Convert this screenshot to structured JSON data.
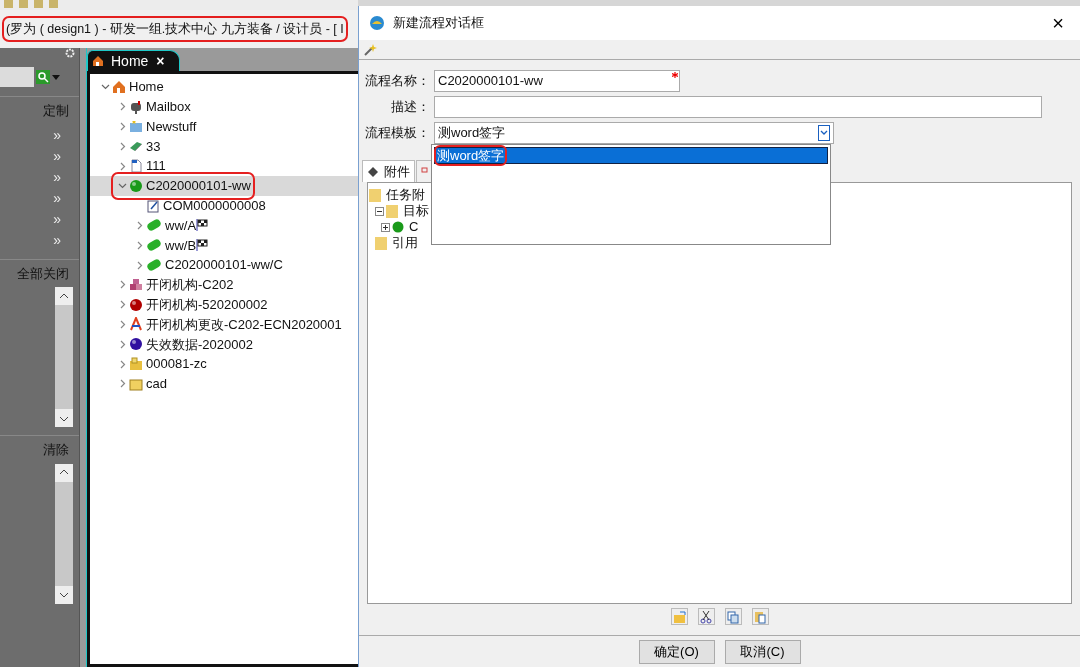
{
  "app_title": {
    "text": "(罗为 ( design1 ) - 研发一组.技术中心 九方装备 / 设计员 - [ I",
    "highlighted": true
  },
  "left_panel": {
    "sections": [
      {
        "button": "定制",
        "rows": [
          "»",
          "»",
          "»",
          "»",
          "»",
          "»"
        ]
      },
      {
        "button": "全部关闭",
        "scroll": true
      },
      {
        "button": "清除",
        "scroll": true
      }
    ]
  },
  "tree_tab": {
    "label": "Home",
    "close": "×"
  },
  "tree": [
    {
      "label": "Home",
      "kind": "house",
      "expanded": true,
      "selected": false,
      "children": [
        {
          "label": "Mailbox",
          "kind": "mailbox",
          "expanded": false,
          "selected": false
        },
        {
          "label": "Newstuff",
          "kind": "folder-star",
          "expanded": false,
          "selected": false
        },
        {
          "label": "33",
          "kind": "book",
          "expanded": false,
          "selected": false
        },
        {
          "label": "111",
          "kind": "document",
          "expanded": false,
          "selected": false
        },
        {
          "label": "C2020000101-ww",
          "kind": "sphere",
          "color": "#1a9a1a",
          "expanded": true,
          "selected": true,
          "highlighted": true,
          "children": [
            {
              "label": "COM0000000008",
              "kind": "note",
              "selected": false
            },
            {
              "label": "ww/A",
              "kind": "pill",
              "flag": true,
              "expanded": false,
              "selected": false
            },
            {
              "label": "ww/B",
              "kind": "pill",
              "flag": true,
              "expanded": false,
              "selected": false
            },
            {
              "label": "C2020000101-ww/C",
              "kind": "pill",
              "expanded": false,
              "selected": false
            }
          ]
        },
        {
          "label": "开闭机构-C202",
          "kind": "cubes",
          "expanded": false,
          "selected": false
        },
        {
          "label": "开闭机构-520200002",
          "kind": "sphere",
          "color": "#b00000",
          "expanded": false,
          "selected": false
        },
        {
          "label": "开闭机构更改-C202-ECN2020001",
          "kind": "compass",
          "expanded": false,
          "selected": false
        },
        {
          "label": "失效数据-2020002",
          "kind": "sphere",
          "color": "#3010a0",
          "expanded": false,
          "selected": false
        },
        {
          "label": "000081-zc",
          "kind": "folder-cubes",
          "expanded": false,
          "selected": false
        },
        {
          "label": "cad",
          "kind": "folder",
          "expanded": false,
          "selected": false
        }
      ]
    }
  ],
  "dialog": {
    "title": "新建流程对话框",
    "close": "×",
    "fields": [
      {
        "kind": "text",
        "label": "流程名称：",
        "value": "C2020000101-ww",
        "required": true
      },
      {
        "kind": "text",
        "label": "描述："
      },
      {
        "kind": "combo",
        "label": "流程模板：",
        "value": "测word签字"
      }
    ],
    "dropdown_options": [
      {
        "label": "测word签字",
        "selected": true,
        "highlighted": true
      }
    ],
    "tabs": [
      {
        "label": "附件",
        "selected": true
      },
      {
        "selected": false
      }
    ],
    "attachments": [
      {
        "label": "任务附",
        "children": [
          {
            "label": "目标",
            "expanded": true,
            "children": [
              {
                "label": "C",
                "expanded": false
              }
            ]
          },
          {
            "label": "引用"
          }
        ]
      }
    ],
    "buttons": [
      "确定(O)",
      "取消(C)"
    ]
  }
}
